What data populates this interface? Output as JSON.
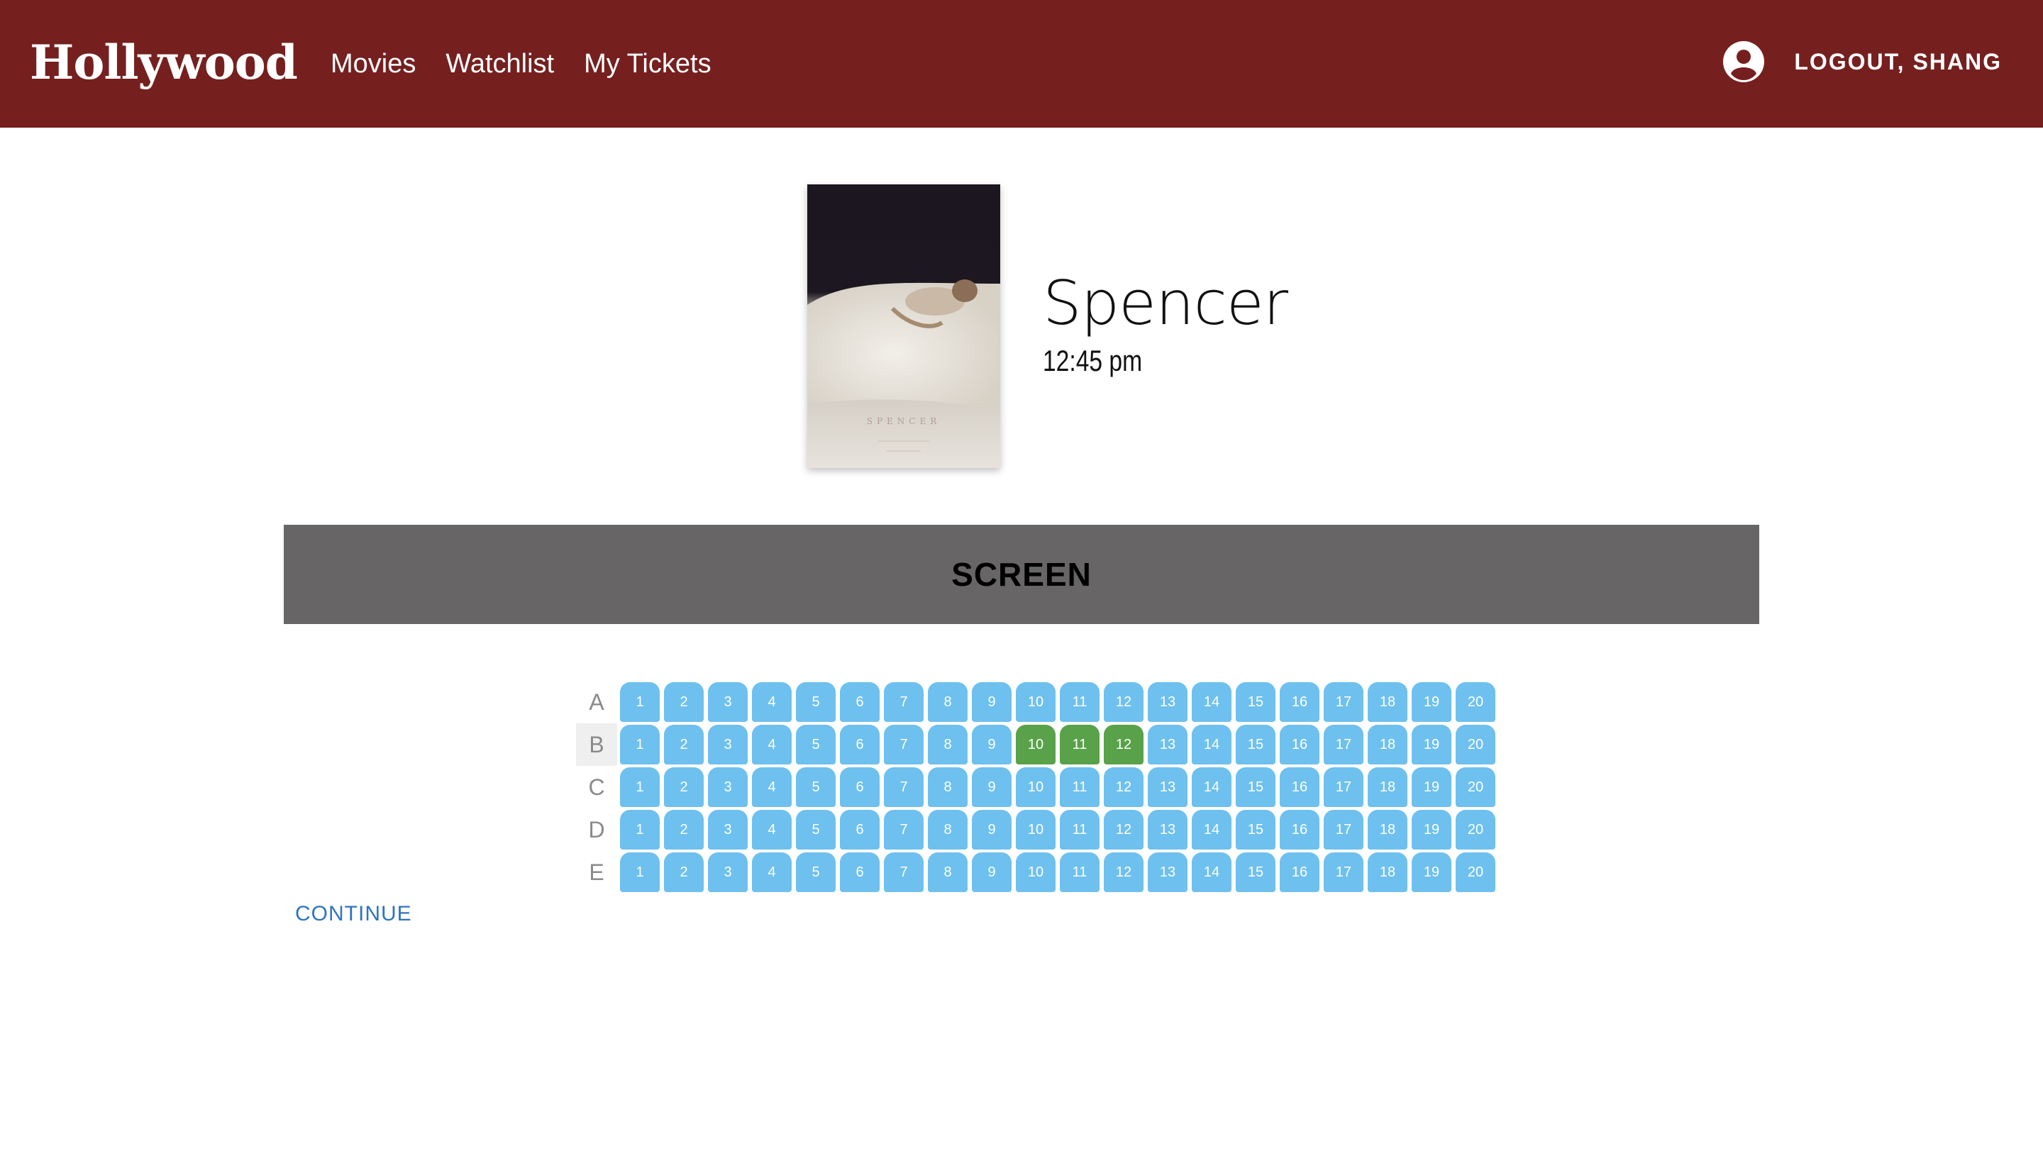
{
  "app": {
    "logo": "Hollywood"
  },
  "nav": {
    "links": [
      "Movies",
      "Watchlist",
      "My Tickets"
    ],
    "logout": "LOGOUT, SHANG"
  },
  "movie": {
    "title": "Spencer",
    "showtime": "12:45 pm",
    "poster_title": "SPENCER"
  },
  "screen": {
    "label": "SCREEN"
  },
  "seating": {
    "rows": [
      "A",
      "B",
      "C",
      "D",
      "E"
    ],
    "seats_per_row": 20,
    "selected_row": "B",
    "selected_seats": [
      10,
      11,
      12
    ],
    "colors": {
      "available": "#6ec0ee",
      "selected": "#59a24a"
    }
  },
  "actions": {
    "continue": "CONTINUE"
  },
  "colors": {
    "navbar": "#75201f",
    "screen": "#676565",
    "link": "#2d74c2"
  }
}
